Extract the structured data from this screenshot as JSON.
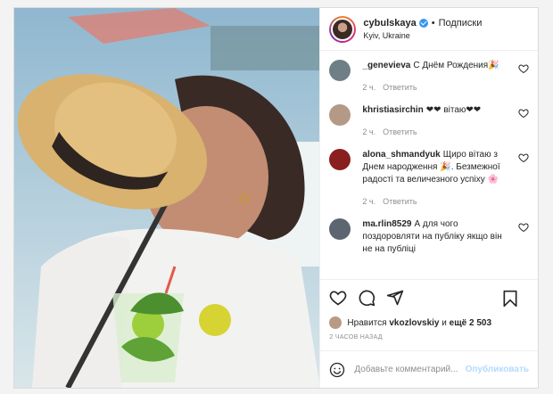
{
  "header": {
    "username": "cybulskaya",
    "separator": "•",
    "follow_label": "Подписки",
    "location": "Kyiv, Ukraine"
  },
  "comments": [
    {
      "user": "_genevieva",
      "text": "С Днём Рождения🎉",
      "time": "2 ч.",
      "reply": "Ответить",
      "avatar_color": "#6f7f86"
    },
    {
      "user": "khristiasirchin",
      "text": "❤❤ вітаю❤❤",
      "time": "2 ч.",
      "reply": "Ответить",
      "avatar_color": "#b49a86"
    },
    {
      "user": "alona_shmandyuk",
      "text": "Щиро вітаю з Днем народження 🎉. Безмежної радості та величезного успіху 🌸",
      "time": "2 ч.",
      "reply": "Ответить",
      "avatar_color": "#8a1f1f"
    },
    {
      "user": "ma.rlin8529",
      "text": "А для чого поздоровляти на публіку якщо він не на публіці",
      "time": "",
      "reply": "",
      "avatar_color": "#5d6670"
    }
  ],
  "likes": {
    "prefix": "Нравится",
    "user": "vkozlovskiy",
    "conjunction": "и",
    "count": "ещё 2 503"
  },
  "time_ago": "2 ЧАСОВ НАЗАД",
  "add_comment": {
    "placeholder": "Добавьте комментарий...",
    "publish_label": "Опубликовать"
  }
}
